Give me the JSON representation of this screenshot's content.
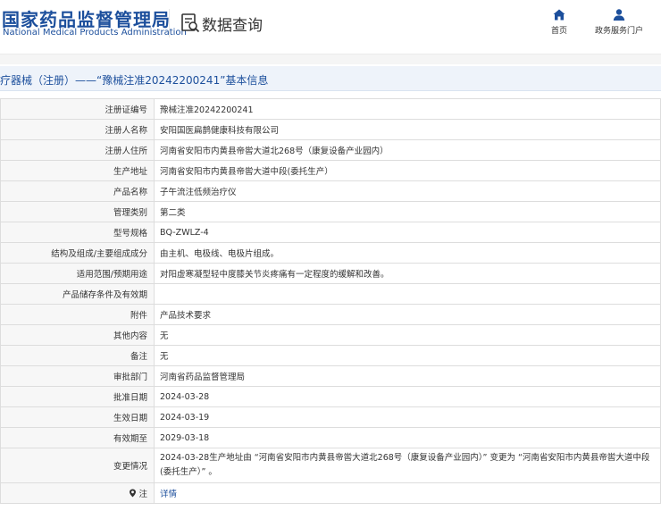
{
  "header": {
    "logo_cn": "国家药品监督管理局",
    "logo_en": "National Medical Products Administration",
    "section_title": "数据查询",
    "section_icon": "data-search-icon",
    "nav": [
      {
        "label": "首页",
        "icon": "home-icon"
      },
      {
        "label": "政务服务门户",
        "icon": "user-icon"
      }
    ]
  },
  "page": {
    "title": "疗器械（注册）——“豫械注准20242200241”基本信息"
  },
  "table": {
    "rows": [
      {
        "label": "注册证编号",
        "value": "豫械注准20242200241"
      },
      {
        "label": "注册人名称",
        "value": "安阳国医扁鹊健康科技有限公司"
      },
      {
        "label": "注册人住所",
        "value": "河南省安阳市内黄县帝喾大道北268号（康复设备产业园内）"
      },
      {
        "label": "生产地址",
        "value": "河南省安阳市内黄县帝喾大道中段(委托生产）"
      },
      {
        "label": "产品名称",
        "value": "子午流注低频治疗仪"
      },
      {
        "label": "管理类别",
        "value": "第二类"
      },
      {
        "label": "型号规格",
        "value": "BQ-ZWLZ-4"
      },
      {
        "label": "结构及组成/主要组成成分",
        "value": "由主机、电极线、电极片组成。"
      },
      {
        "label": "适用范围/预期用途",
        "value": "对阳虚寒凝型轻中度膝关节炎疼痛有一定程度的缓解和改善。"
      },
      {
        "label": "产品储存条件及有效期",
        "value": ""
      },
      {
        "label": "附件",
        "value": "产品技术要求"
      },
      {
        "label": "其他内容",
        "value": "无"
      },
      {
        "label": "备注",
        "value": "无"
      },
      {
        "label": "审批部门",
        "value": "河南省药品监督管理局"
      },
      {
        "label": "批准日期",
        "value": "2024-03-28"
      },
      {
        "label": "生效日期",
        "value": "2024-03-19"
      },
      {
        "label": "有效期至",
        "value": "2029-03-18"
      },
      {
        "label": "变更情况",
        "value": "2024-03-28生产地址由 “河南省安阳市内黄县帝喾大道北268号（康复设备产业园内）” 变更为 “河南省安阳市内黄县帝喾大道中段(委托生产）” 。"
      }
    ],
    "note_row": {
      "label": "注",
      "icon": "pin-icon",
      "link": "详情"
    }
  },
  "colors": {
    "brand": "#1c4f9c",
    "title_bar_bg": "#eef3fa",
    "label_bg": "#f7f7f7",
    "border": "#dddddd"
  }
}
